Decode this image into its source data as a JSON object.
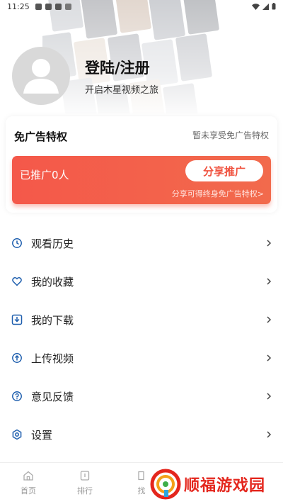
{
  "status_bar": {
    "time": "11:25"
  },
  "profile": {
    "title": "登陆/注册",
    "subtitle": "开启木星视频之旅"
  },
  "ad_card": {
    "title": "免广告特权",
    "status": "暂未享受免广告特权",
    "promo_count": "已推广0人",
    "share_button": "分享推广",
    "promo_note": "分享可得终身免广告特权>",
    "accent_color": "#f4584a"
  },
  "menu": {
    "items": [
      {
        "label": "观看历史",
        "icon": "history-icon"
      },
      {
        "label": "我的收藏",
        "icon": "heart-icon"
      },
      {
        "label": "我的下载",
        "icon": "download-icon"
      },
      {
        "label": "上传视频",
        "icon": "upload-icon"
      },
      {
        "label": "意见反馈",
        "icon": "help-icon"
      },
      {
        "label": "设置",
        "icon": "gear-icon"
      }
    ]
  },
  "bottom_nav": {
    "items": [
      {
        "label": "首页",
        "icon": "home-icon"
      },
      {
        "label": "排行",
        "icon": "rank-icon"
      },
      {
        "label": "找",
        "icon": "find-icon"
      }
    ]
  },
  "watermark": {
    "text": "顺福游戏园"
  }
}
